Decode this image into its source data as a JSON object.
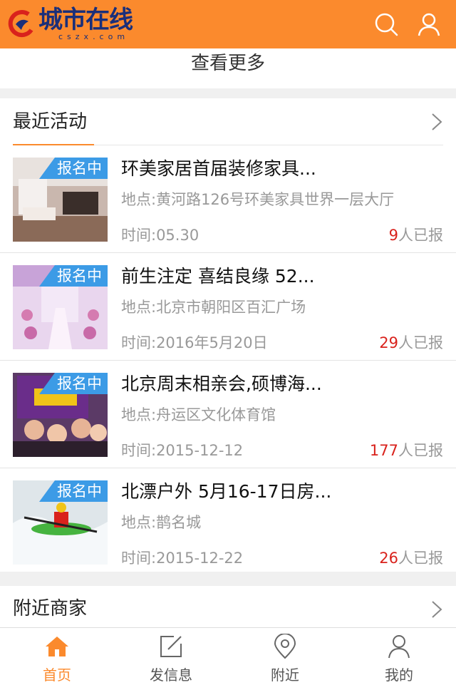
{
  "header": {
    "logo_cn": "城市在线",
    "logo_en": "cszx.com",
    "search_icon": "search-icon",
    "user_icon": "user-icon",
    "bg_color": "#fb8a2d"
  },
  "more_link": "查看更多",
  "activities": {
    "title": "最近活动",
    "items": [
      {
        "badge": "报名中",
        "title": "环美家居首届装修家具...",
        "location": "地点:黄河路126号环美家具世界一层大厅",
        "time": "时间:05.30",
        "count": "9",
        "count_suffix": "人已报"
      },
      {
        "badge": "报名中",
        "title": "前生注定 喜结良缘 52...",
        "location": "地点:北京市朝阳区百汇广场",
        "time": "时间:2016年5月20日",
        "count": "29",
        "count_suffix": "人已报"
      },
      {
        "badge": "报名中",
        "title": "北京周末相亲会,硕博海...",
        "location": "地点:舟运区文化体育馆",
        "time": "时间:2015-12-12",
        "count": "177",
        "count_suffix": "人已报"
      },
      {
        "badge": "报名中",
        "title": "北漂户外 5月16-17日房...",
        "location": "地点:鹊名城",
        "time": "时间:2015-12-22",
        "count": "26",
        "count_suffix": "人已报"
      }
    ]
  },
  "merchants": {
    "title": "附近商家"
  },
  "tabbar": {
    "tabs": [
      {
        "label": "首页",
        "icon": "home-icon",
        "active": true
      },
      {
        "label": "发信息",
        "icon": "edit-icon",
        "active": false
      },
      {
        "label": "附近",
        "icon": "location-pin-icon",
        "active": false
      },
      {
        "label": "我的",
        "icon": "user-icon",
        "active": false
      }
    ]
  },
  "colors": {
    "accent": "#fb8a2d",
    "badge": "#3c9be6",
    "count": "#d9221c"
  }
}
